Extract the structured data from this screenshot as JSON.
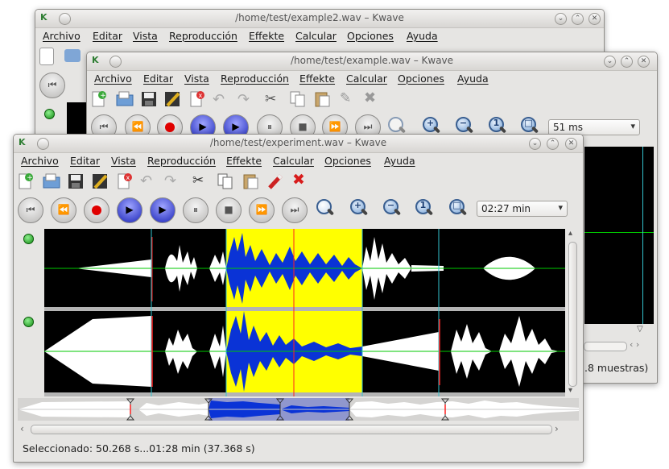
{
  "windows": {
    "back": {
      "title": "/home/test/example2.wav – Kwave",
      "menu": [
        "Archivo",
        "Editar",
        "Vista",
        "Reproducción",
        "Effekte",
        "Calcular",
        "Opciones",
        "Ayuda"
      ]
    },
    "middle": {
      "title": "/home/test/example.wav – Kwave",
      "menu": [
        "Archivo",
        "Editar",
        "Vista",
        "Reproducción",
        "Effekte",
        "Calcular",
        "Opciones",
        "Ayuda"
      ],
      "zoom_value": "51 ms",
      "status_partial": ".8 muestras)"
    },
    "front": {
      "title": "/home/test/experiment.wav – Kwave",
      "menu": [
        "Archivo",
        "Editar",
        "Vista",
        "Reproducción",
        "Effekte",
        "Calcular",
        "Opciones",
        "Ayuda"
      ],
      "zoom_value": "02:27 min",
      "status": "Seleccionado: 50.268 s...01:28 min (37.368 s)"
    }
  },
  "app_icon_label": "K",
  "colors": {
    "selection": "#ffff00",
    "waveform": "#ffffff",
    "waveform_selected": "#0a33d6",
    "wave_background": "#000000",
    "zero_line": "#00c800",
    "marker": "#ff2020",
    "label_line": "#33c3d0"
  }
}
